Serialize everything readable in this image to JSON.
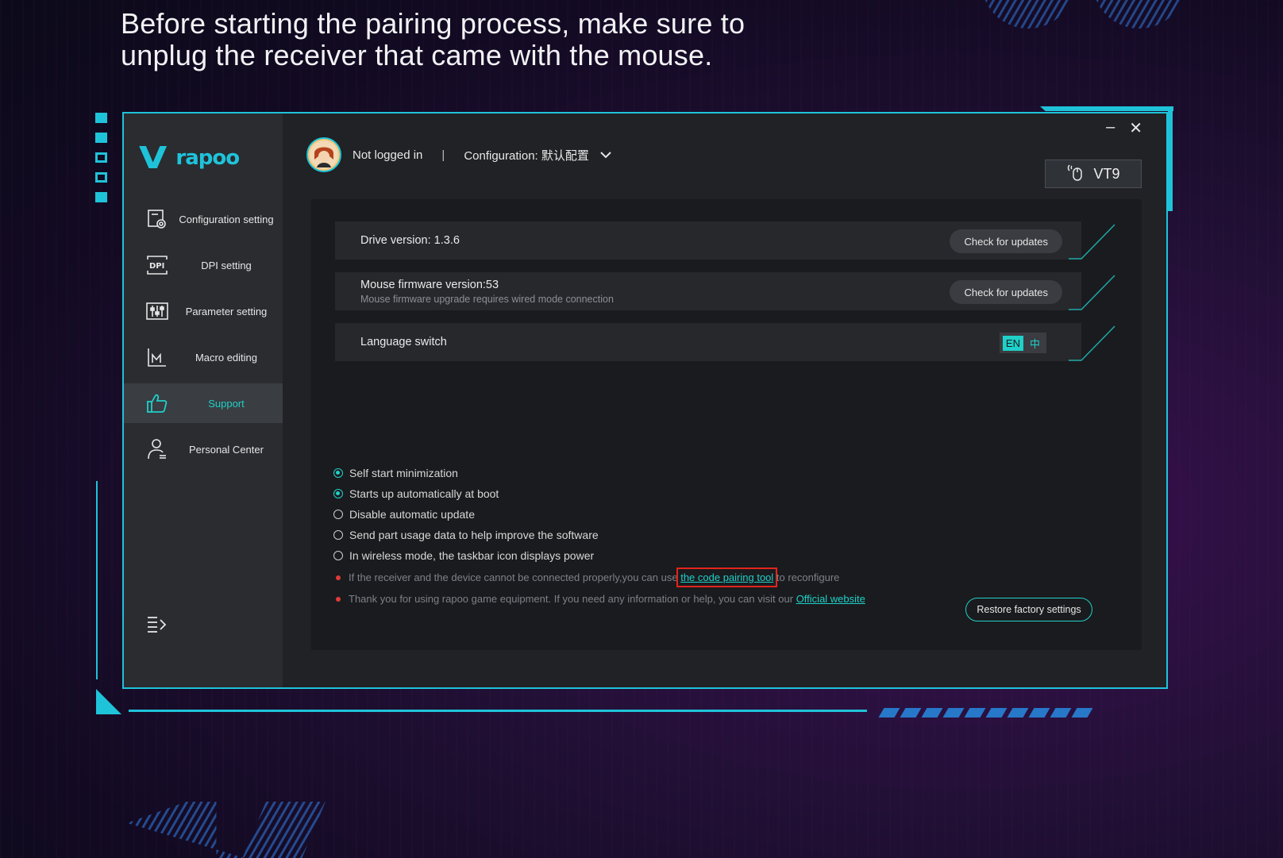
{
  "headline": {
    "line1": "Before starting the pairing process, make sure to",
    "line2": "unplug the receiver that came with the mouse."
  },
  "brand": {
    "logo_mark": "V",
    "logo_text": "rapoo",
    "accent": "#1fc3d9"
  },
  "sidebar": {
    "items": [
      {
        "label": "Configuration setting",
        "icon": "config-icon"
      },
      {
        "label": "DPI setting",
        "icon": "dpi-icon"
      },
      {
        "label": "Parameter setting",
        "icon": "sliders-icon"
      },
      {
        "label": "Macro editing",
        "icon": "macro-icon"
      },
      {
        "label": "Support",
        "icon": "thumbs-up-icon",
        "active": true
      },
      {
        "label": "Personal Center",
        "icon": "user-icon"
      }
    ]
  },
  "topbar": {
    "login_status": "Not logged in",
    "separator": "|",
    "config_label": "Configuration: 默认配置",
    "device": "VT9"
  },
  "window_controls": {
    "minimize": "–",
    "close": "✕"
  },
  "rows": {
    "drive": {
      "title": "Drive version: 1.3.6",
      "button": "Check for updates"
    },
    "firmware": {
      "title": "Mouse firmware version:53",
      "subtitle": "Mouse firmware upgrade requires wired mode connection",
      "button": "Check for updates"
    },
    "language": {
      "title": "Language switch",
      "en": "EN",
      "zh": "中",
      "selected": "EN"
    }
  },
  "options": [
    {
      "label": "Self start minimization",
      "checked": true
    },
    {
      "label": "Starts up automatically at boot",
      "checked": true
    },
    {
      "label": "Disable automatic update",
      "checked": false
    },
    {
      "label": "Send part usage data to help improve the software",
      "checked": false
    },
    {
      "label": "In wireless mode, the taskbar icon displays power",
      "checked": false
    }
  ],
  "notes": {
    "pairing_before": "If the receiver and the device cannot be connected properly,you can use",
    "pairing_link": "the code pairing tool",
    "pairing_after": "to reconfigure",
    "website_before": "Thank you for using rapoo game equipment. If you need any information or help, you can visit our",
    "website_link": "Official website"
  },
  "restore_button": "Restore factory settings"
}
